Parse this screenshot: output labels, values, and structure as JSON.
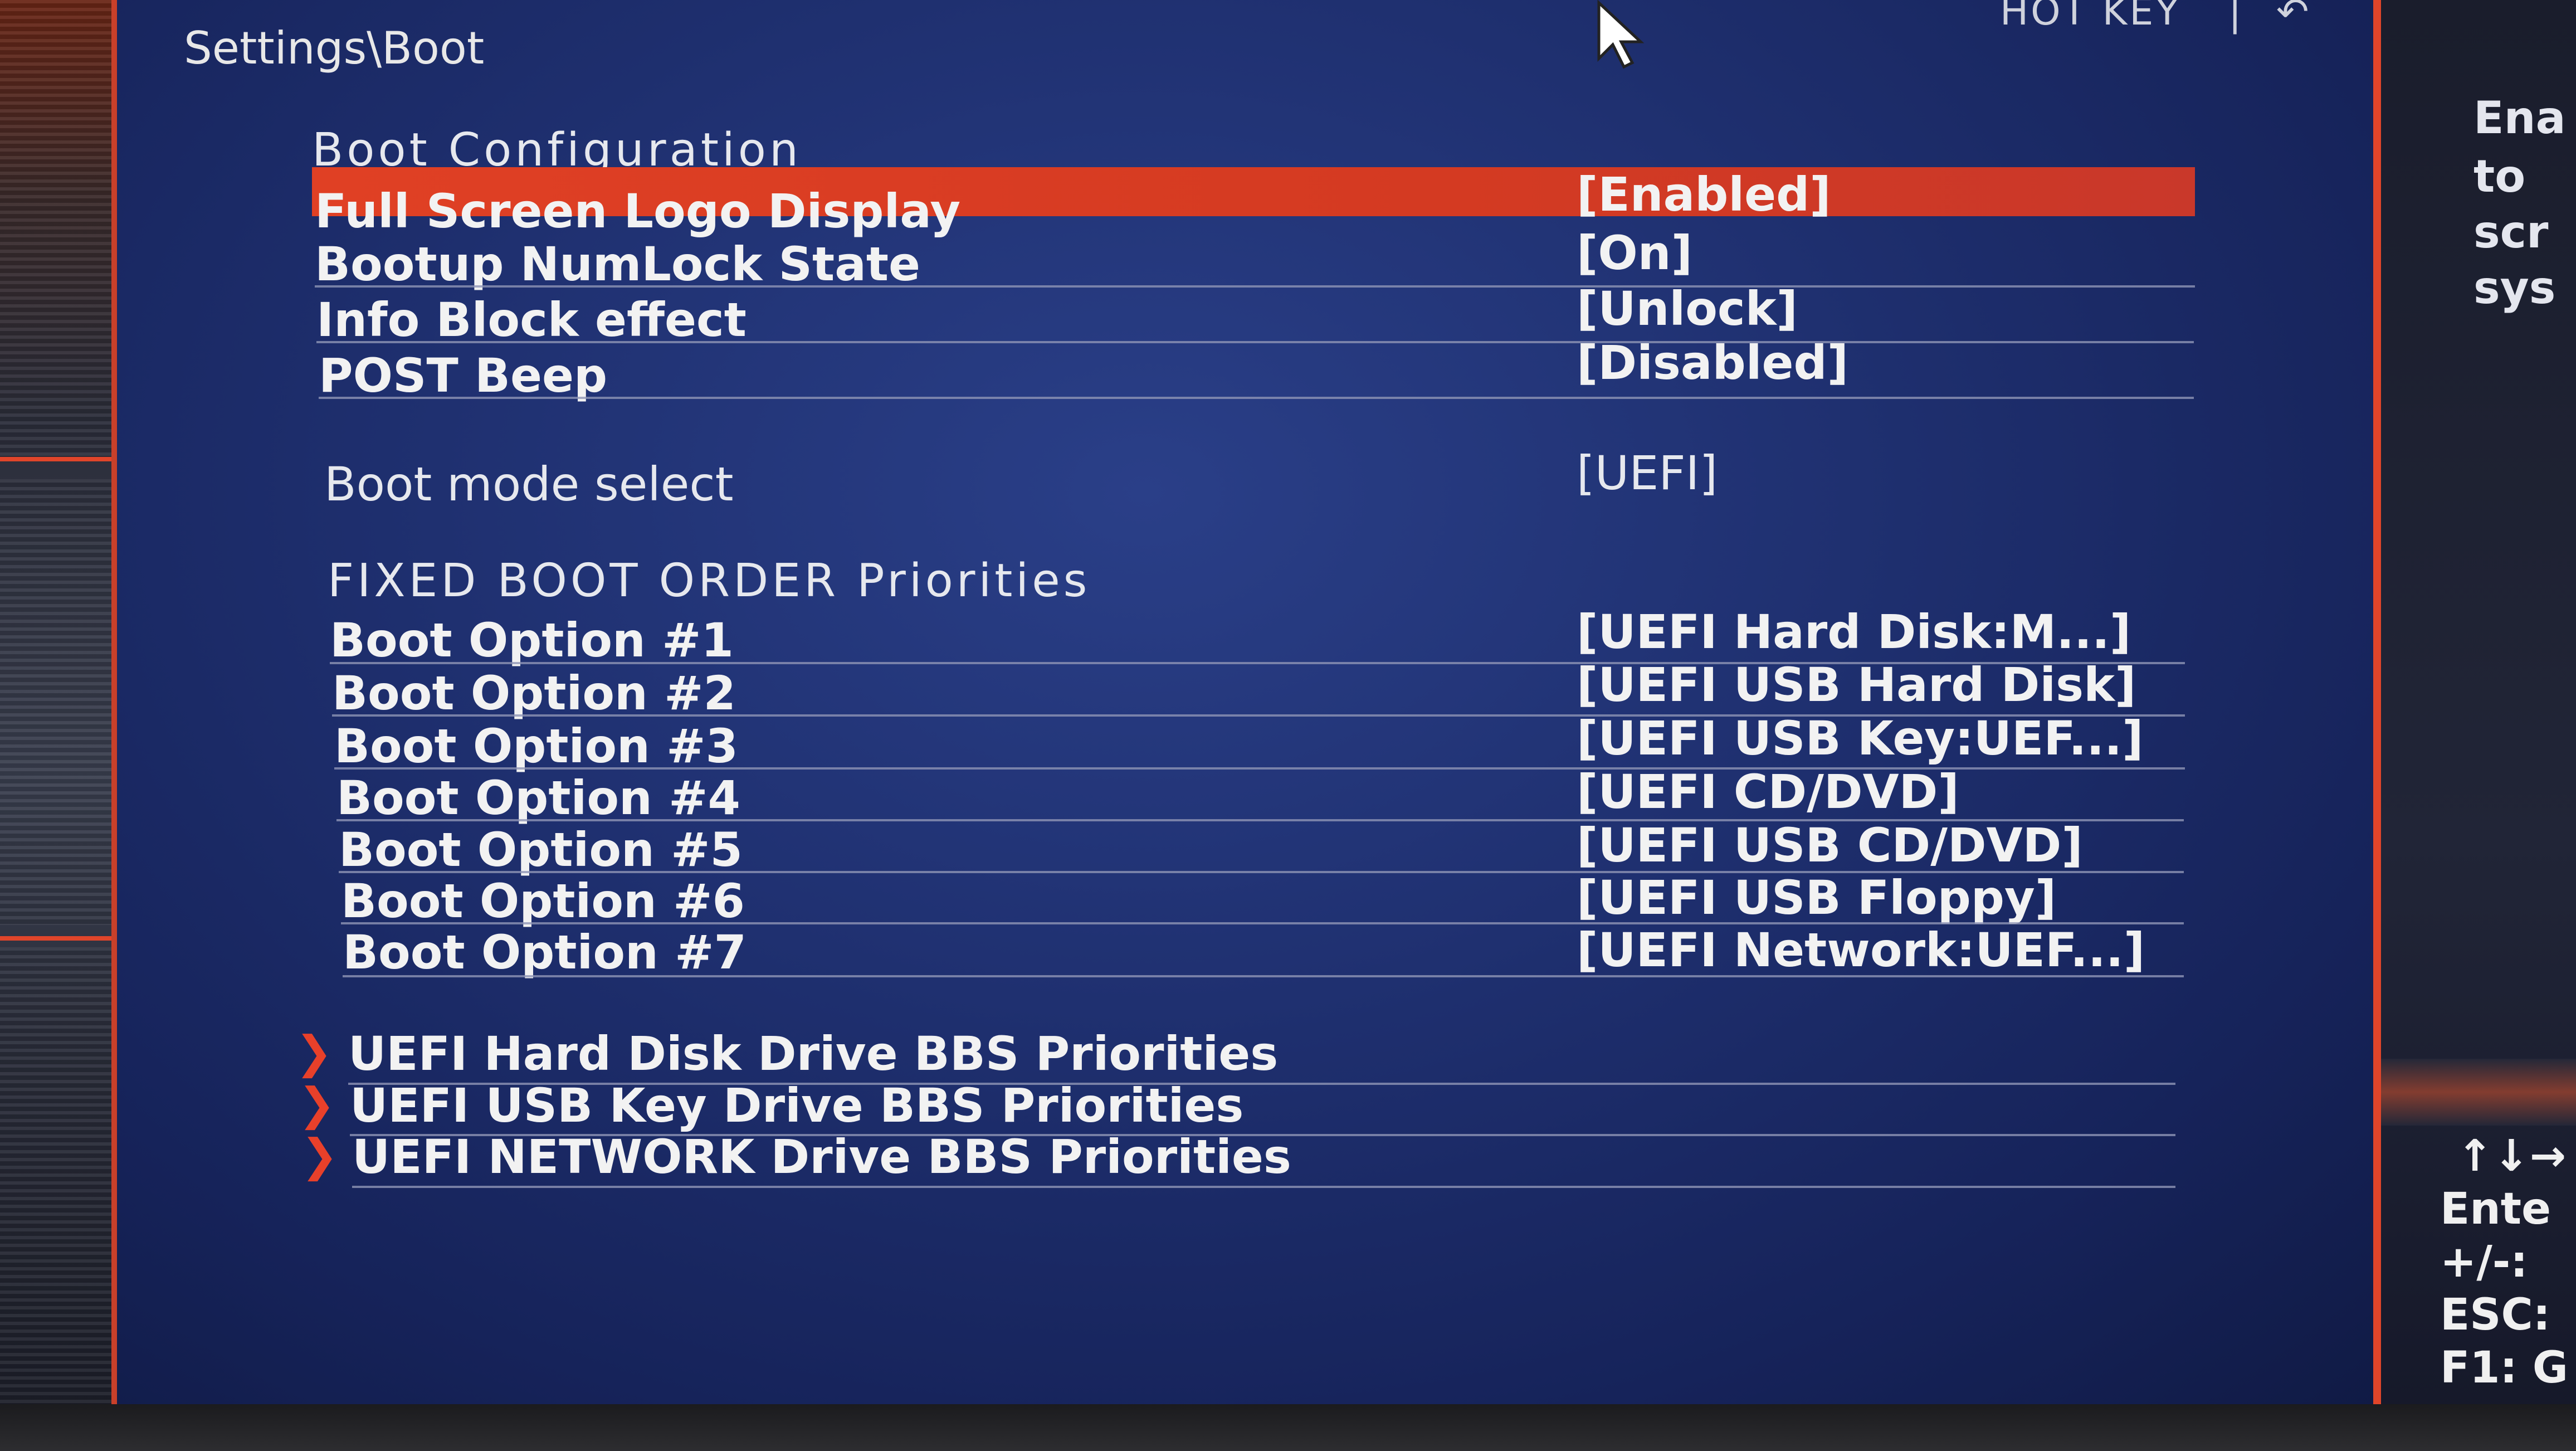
{
  "colors": {
    "highlight": "#e04024",
    "accent": "#e0452a",
    "background": "#1f3070",
    "text": "#f2f2f2"
  },
  "breadcrumb": "Settings\\Boot",
  "hotkey": {
    "label": "HOT KEY",
    "separator": "|",
    "back_icon": "back-arrow-icon"
  },
  "boot_configuration": {
    "title": "Boot  Configuration",
    "items": [
      {
        "label": "Full Screen Logo Display",
        "value": "[Enabled]",
        "selected": true
      },
      {
        "label": "Bootup NumLock State",
        "value": "[On]",
        "selected": false
      },
      {
        "label": "Info Block effect",
        "value": "[Unlock]",
        "selected": false
      },
      {
        "label": "POST Beep",
        "value": "[Disabled]",
        "selected": false
      }
    ]
  },
  "boot_mode": {
    "label": "Boot mode select",
    "value": "[UEFI]"
  },
  "fixed_boot_order": {
    "title": "FIXED  BOOT  ORDER  Priorities",
    "items": [
      {
        "label": "Boot Option #1",
        "value": "[UEFI Hard Disk:M...]"
      },
      {
        "label": "Boot Option #2",
        "value": "[UEFI USB Hard Disk]"
      },
      {
        "label": "Boot Option #3",
        "value": "[UEFI USB Key:UEF...]"
      },
      {
        "label": "Boot Option #4",
        "value": "[UEFI CD/DVD]"
      },
      {
        "label": "Boot Option #5",
        "value": "[UEFI USB CD/DVD]"
      },
      {
        "label": "Boot Option #6",
        "value": "[UEFI USB Floppy]"
      },
      {
        "label": "Boot Option #7",
        "value": "[UEFI Network:UEF...]"
      }
    ]
  },
  "submenus": [
    {
      "label": "UEFI Hard Disk Drive BBS Priorities"
    },
    {
      "label": "UEFI USB Key Drive BBS Priorities"
    },
    {
      "label": "UEFI NETWORK Drive BBS Priorities"
    }
  ],
  "help_panel": {
    "lines": [
      "Ena",
      "to",
      "scr",
      "sys"
    ]
  },
  "key_legend": {
    "lines": [
      "↑↓→",
      "Ente",
      "+/-:",
      "ESC:",
      "F1: G"
    ]
  }
}
